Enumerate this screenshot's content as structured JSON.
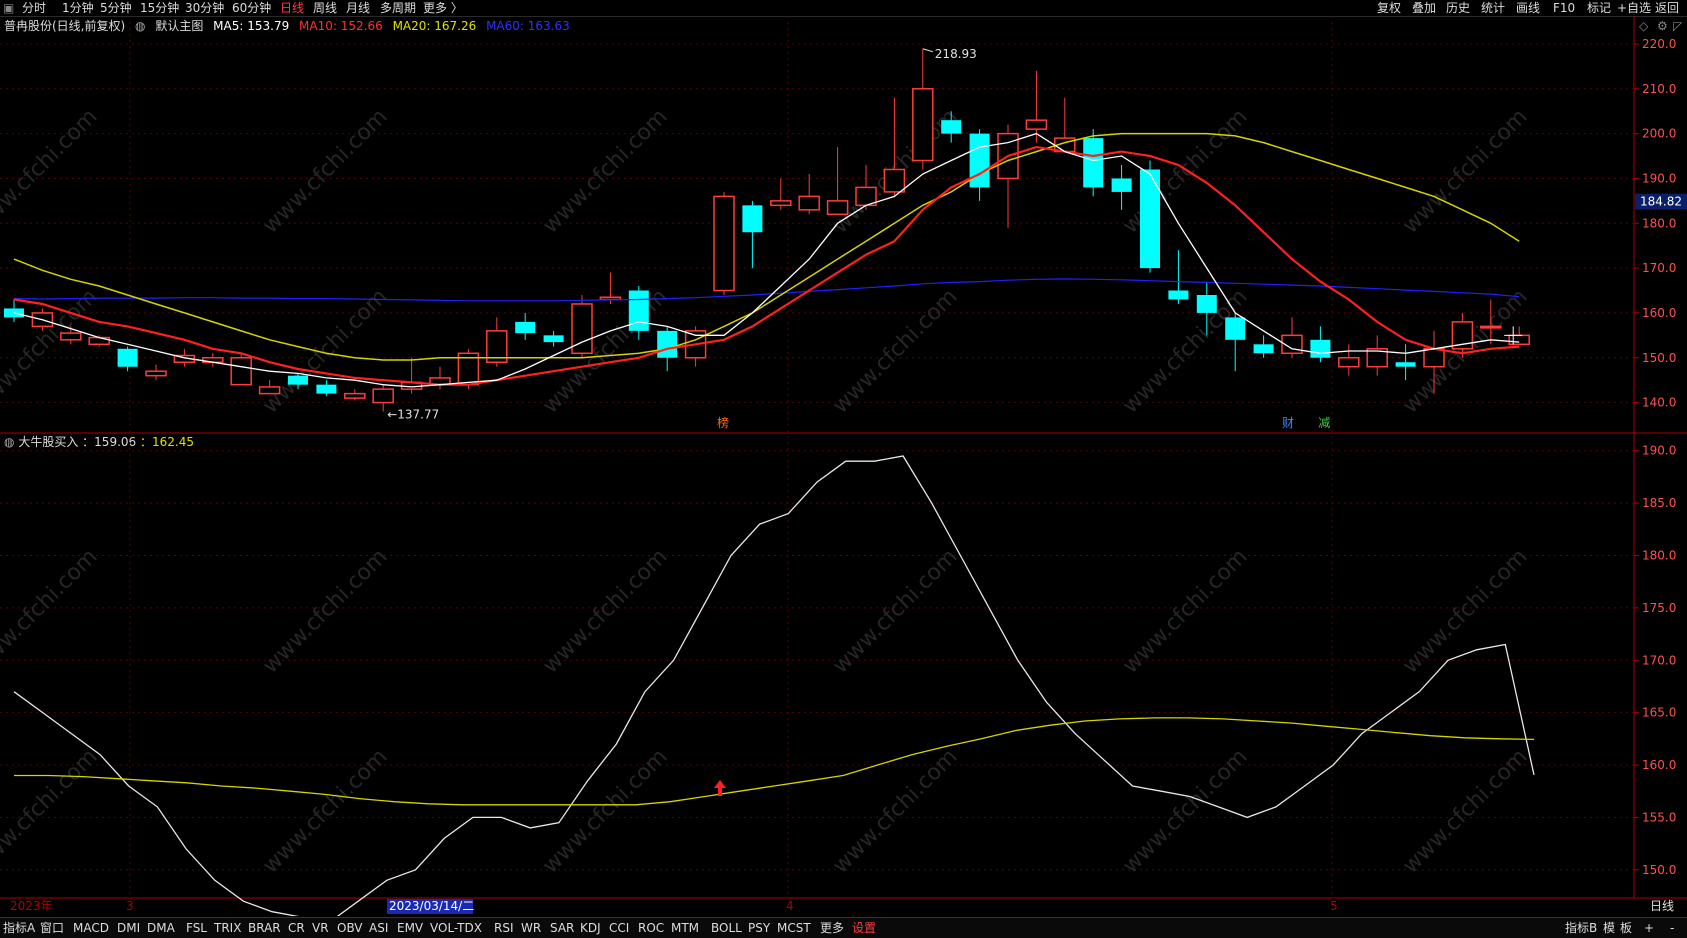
{
  "topbar": {
    "items_left": [
      "分时",
      "1分钟",
      "5分钟",
      "15分钟",
      "30分钟",
      "60分钟",
      "日线",
      "周线",
      "月线",
      "多周期",
      "更多 〉"
    ],
    "active_item": "日线",
    "items_right": [
      "复权",
      "叠加",
      "历史",
      "统计",
      "画线",
      "F10",
      "标记",
      "+自选",
      "返回"
    ]
  },
  "main_info": {
    "name": "普冉股份(日线,前复权)",
    "template": "默认主图",
    "ma5": "MA5: 153.79",
    "ma10": "MA10: 152.66",
    "ma20": "MA20: 167.26",
    "ma60": "MA60: 163.63"
  },
  "colors": {
    "up": "#ff3c3c",
    "down": "#00ffff",
    "ma5": "#ffffff",
    "ma10": "#ff2020",
    "ma20": "#d4d400",
    "ma60": "#2020ff",
    "grid": "#5a0000",
    "axis": "#b00000",
    "label": "#ff5050",
    "bg": "#000000",
    "price_tag_bg": "#0a1f6a"
  },
  "indicator_info": {
    "name": "大牛股买入",
    "v1": "159.06",
    "v2": "162.45"
  },
  "main_axis_labels": [
    "220.0",
    "210.0",
    "200.0",
    "190.0",
    "180.0",
    "170.0",
    "160.0",
    "150.0",
    "140.0"
  ],
  "sub_axis_labels": [
    "190.0",
    "185.0",
    "180.0",
    "175.0",
    "170.0",
    "165.0",
    "160.0",
    "155.0",
    "150.0"
  ],
  "current_price_tag": "184.82",
  "annotations": {
    "high_label": "218.93",
    "low_label": "137.77",
    "marker_bang": "榜",
    "marker_cai": "财",
    "marker_jian": "减"
  },
  "date_axis": {
    "year": "2023年",
    "m3": "3",
    "cursor_date": "2023/03/14/二",
    "m4": "4",
    "m5": "5",
    "period": "日线"
  },
  "bottom_tabs": [
    "指标A",
    "窗口",
    "MACD",
    "DMI",
    "DMA",
    "FSL",
    "TRIX",
    "BRAR",
    "CR",
    "VR",
    "OBV",
    "ASI",
    "EMV",
    "VOL-TDX",
    "RSI",
    "WR",
    "SAR",
    "KDJ",
    "CCI",
    "ROC",
    "MTM",
    "BOLL",
    "PSY",
    "MCST",
    "更多",
    "设置"
  ],
  "bottom_tab_active": "设置",
  "bottom_right_tabs": [
    "指标B",
    "模",
    "板",
    "+",
    "-"
  ],
  "watermark": "www.cfchi.com",
  "chart_data": {
    "type": "candlestick",
    "main_ylim": [
      135,
      222
    ],
    "candles": [
      [
        161,
        159,
        163,
        158
      ],
      [
        157,
        160,
        161,
        156
      ],
      [
        154,
        155.5,
        157,
        153
      ],
      [
        153,
        154.5,
        155,
        152.5
      ],
      [
        152,
        148,
        152.5,
        147
      ],
      [
        146,
        147,
        148.5,
        145
      ],
      [
        149,
        150.5,
        152,
        148
      ],
      [
        149,
        150,
        151,
        148
      ],
      [
        144,
        150,
        151,
        144
      ],
      [
        142,
        143.5,
        145,
        142
      ],
      [
        146,
        144,
        146.5,
        143
      ],
      [
        144,
        142,
        145,
        141.5
      ],
      [
        141,
        142,
        143,
        140.5
      ],
      [
        140,
        143,
        144,
        138
      ],
      [
        143,
        144.5,
        150,
        142
      ],
      [
        144,
        145.5,
        148,
        143
      ],
      [
        144,
        151,
        152,
        143
      ],
      [
        149,
        156,
        159,
        148
      ],
      [
        158,
        155.5,
        160,
        154
      ],
      [
        155,
        153.5,
        156,
        152.5
      ],
      [
        151,
        162,
        164,
        150
      ],
      [
        163,
        163.5,
        169,
        162
      ],
      [
        165,
        156,
        166,
        154
      ],
      [
        156,
        150,
        157,
        147
      ],
      [
        150,
        156,
        157,
        148
      ],
      [
        165,
        186,
        187,
        164
      ],
      [
        184,
        178,
        185,
        170
      ],
      [
        184,
        185,
        190,
        183
      ],
      [
        183,
        186,
        191,
        182
      ],
      [
        182,
        185,
        197,
        182
      ],
      [
        184,
        188,
        193,
        183
      ],
      [
        187,
        192,
        208,
        186
      ],
      [
        194,
        210,
        218.93,
        192
      ],
      [
        203,
        200,
        205,
        198
      ],
      [
        200,
        188,
        201,
        185
      ],
      [
        190,
        200,
        202,
        179
      ],
      [
        201,
        203,
        214,
        198
      ],
      [
        196,
        199,
        208,
        196
      ],
      [
        199,
        188,
        201,
        186
      ],
      [
        190,
        187,
        193,
        183
      ],
      [
        192,
        170,
        194,
        169
      ],
      [
        165,
        163,
        174,
        162
      ],
      [
        164,
        160,
        167,
        155
      ],
      [
        159,
        154,
        160,
        147
      ],
      [
        153,
        151,
        155,
        150
      ],
      [
        151,
        155,
        159,
        150
      ],
      [
        154,
        150,
        157,
        149
      ],
      [
        148,
        150,
        153,
        146
      ],
      [
        148,
        152,
        155,
        146
      ],
      [
        149,
        148,
        153,
        145
      ],
      [
        148,
        152,
        156,
        142
      ],
      [
        152,
        158,
        160,
        150
      ],
      [
        157,
        157,
        163,
        153
      ],
      [
        153,
        155,
        157,
        153
      ]
    ],
    "ma5": [
      160,
      158.5,
      156.5,
      154.5,
      153,
      151.5,
      150,
      149,
      148,
      147,
      146.5,
      145.5,
      145,
      144,
      143.5,
      144,
      144.5,
      145,
      147.5,
      150.5,
      153.5,
      156,
      158,
      157,
      155,
      155,
      160,
      166,
      172,
      180,
      184,
      186,
      191,
      194,
      197,
      198,
      200,
      196,
      194,
      195,
      191,
      180,
      170,
      160,
      156,
      152,
      151,
      151.5,
      151.5,
      151,
      152,
      153,
      154,
      153.5
    ],
    "ma10": [
      163,
      162,
      160,
      158,
      157,
      155.5,
      154,
      152,
      151,
      149,
      147.5,
      146.5,
      145.5,
      145,
      144.5,
      144,
      144,
      145,
      146,
      147,
      148,
      149,
      150,
      152,
      153,
      154,
      157,
      161,
      165,
      169,
      173,
      176,
      183,
      188,
      191,
      195,
      197,
      196,
      195,
      196,
      195,
      193,
      189,
      184,
      178,
      172,
      167,
      163,
      158,
      154,
      152,
      151,
      152,
      152.5
    ],
    "ma20": [
      172,
      169.5,
      167.5,
      166,
      164,
      162,
      160,
      158,
      156,
      154,
      152.5,
      151,
      150,
      149.5,
      149.5,
      150,
      150,
      150,
      150,
      150,
      150,
      150.5,
      151,
      152,
      154,
      157,
      160,
      164,
      168,
      172,
      176,
      180,
      184,
      187,
      191,
      194,
      196,
      198,
      199.5,
      200,
      200,
      200,
      200,
      199.5,
      198,
      196,
      194,
      192,
      190,
      188,
      186,
      183,
      180,
      176
    ],
    "ma60": [
      163.2,
      163.1,
      163.2,
      163.3,
      163.3,
      163.3,
      163.4,
      163.4,
      163.3,
      163.3,
      163.2,
      163.2,
      163.1,
      163,
      162.9,
      162.8,
      162.7,
      162.7,
      162.7,
      162.7,
      162.8,
      162.9,
      163,
      163.2,
      163.4,
      163.7,
      164,
      164.4,
      164.8,
      165.2,
      165.6,
      166,
      166.5,
      166.8,
      167,
      167.3,
      167.5,
      167.6,
      167.5,
      167.4,
      167.2,
      167,
      166.8,
      166.6,
      166.4,
      166.2,
      166,
      165.7,
      165.4,
      165.1,
      164.8,
      164.5,
      164.2,
      163.63
    ],
    "sub_ylim": [
      147.5,
      191.5
    ],
    "sub_white": [
      167,
      165,
      163,
      161,
      158,
      156,
      152,
      149,
      147,
      146,
      145.5,
      145,
      147,
      149,
      150,
      153,
      155,
      155,
      154,
      154.5,
      158.5,
      162,
      167,
      170,
      175,
      180,
      183,
      184,
      187,
      189,
      189,
      189.5,
      185,
      180,
      175,
      170,
      166,
      163,
      160.5,
      158,
      157.5,
      157,
      156,
      155,
      156,
      158,
      160,
      163,
      165,
      167,
      170,
      171,
      171.5,
      159.06
    ],
    "sub_yellow": [
      159,
      159,
      158.9,
      158.7,
      158.5,
      158.3,
      158,
      157.8,
      157.5,
      157.2,
      156.8,
      156.5,
      156.3,
      156.2,
      156.2,
      156.2,
      156.2,
      156.2,
      156.2,
      156.5,
      157,
      157.5,
      158,
      158.5,
      159,
      160,
      161,
      161.8,
      162.5,
      163.3,
      163.8,
      164.2,
      164.4,
      164.5,
      164.5,
      164.4,
      164.2,
      164,
      163.7,
      163.4,
      163.1,
      162.8,
      162.6,
      162.5,
      162.45
    ]
  }
}
